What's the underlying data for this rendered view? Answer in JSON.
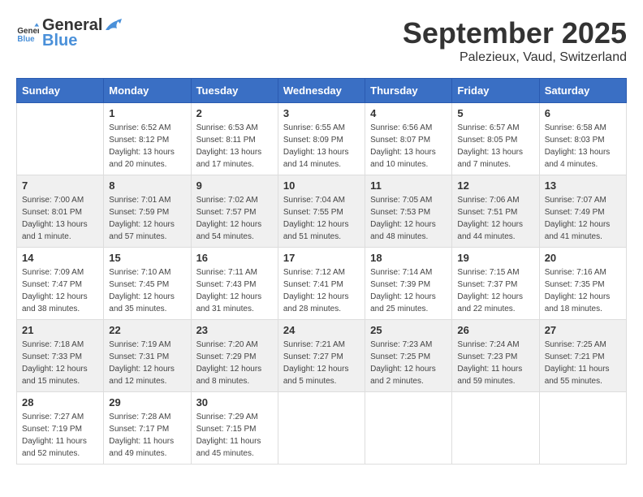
{
  "header": {
    "logo_general": "General",
    "logo_blue": "Blue",
    "month": "September 2025",
    "location": "Palezieux, Vaud, Switzerland"
  },
  "weekdays": [
    "Sunday",
    "Monday",
    "Tuesday",
    "Wednesday",
    "Thursday",
    "Friday",
    "Saturday"
  ],
  "weeks": [
    [
      {
        "day": "",
        "info": ""
      },
      {
        "day": "1",
        "info": "Sunrise: 6:52 AM\nSunset: 8:12 PM\nDaylight: 13 hours\nand 20 minutes."
      },
      {
        "day": "2",
        "info": "Sunrise: 6:53 AM\nSunset: 8:11 PM\nDaylight: 13 hours\nand 17 minutes."
      },
      {
        "day": "3",
        "info": "Sunrise: 6:55 AM\nSunset: 8:09 PM\nDaylight: 13 hours\nand 14 minutes."
      },
      {
        "day": "4",
        "info": "Sunrise: 6:56 AM\nSunset: 8:07 PM\nDaylight: 13 hours\nand 10 minutes."
      },
      {
        "day": "5",
        "info": "Sunrise: 6:57 AM\nSunset: 8:05 PM\nDaylight: 13 hours\nand 7 minutes."
      },
      {
        "day": "6",
        "info": "Sunrise: 6:58 AM\nSunset: 8:03 PM\nDaylight: 13 hours\nand 4 minutes."
      }
    ],
    [
      {
        "day": "7",
        "info": "Sunrise: 7:00 AM\nSunset: 8:01 PM\nDaylight: 13 hours\nand 1 minute."
      },
      {
        "day": "8",
        "info": "Sunrise: 7:01 AM\nSunset: 7:59 PM\nDaylight: 12 hours\nand 57 minutes."
      },
      {
        "day": "9",
        "info": "Sunrise: 7:02 AM\nSunset: 7:57 PM\nDaylight: 12 hours\nand 54 minutes."
      },
      {
        "day": "10",
        "info": "Sunrise: 7:04 AM\nSunset: 7:55 PM\nDaylight: 12 hours\nand 51 minutes."
      },
      {
        "day": "11",
        "info": "Sunrise: 7:05 AM\nSunset: 7:53 PM\nDaylight: 12 hours\nand 48 minutes."
      },
      {
        "day": "12",
        "info": "Sunrise: 7:06 AM\nSunset: 7:51 PM\nDaylight: 12 hours\nand 44 minutes."
      },
      {
        "day": "13",
        "info": "Sunrise: 7:07 AM\nSunset: 7:49 PM\nDaylight: 12 hours\nand 41 minutes."
      }
    ],
    [
      {
        "day": "14",
        "info": "Sunrise: 7:09 AM\nSunset: 7:47 PM\nDaylight: 12 hours\nand 38 minutes."
      },
      {
        "day": "15",
        "info": "Sunrise: 7:10 AM\nSunset: 7:45 PM\nDaylight: 12 hours\nand 35 minutes."
      },
      {
        "day": "16",
        "info": "Sunrise: 7:11 AM\nSunset: 7:43 PM\nDaylight: 12 hours\nand 31 minutes."
      },
      {
        "day": "17",
        "info": "Sunrise: 7:12 AM\nSunset: 7:41 PM\nDaylight: 12 hours\nand 28 minutes."
      },
      {
        "day": "18",
        "info": "Sunrise: 7:14 AM\nSunset: 7:39 PM\nDaylight: 12 hours\nand 25 minutes."
      },
      {
        "day": "19",
        "info": "Sunrise: 7:15 AM\nSunset: 7:37 PM\nDaylight: 12 hours\nand 22 minutes."
      },
      {
        "day": "20",
        "info": "Sunrise: 7:16 AM\nSunset: 7:35 PM\nDaylight: 12 hours\nand 18 minutes."
      }
    ],
    [
      {
        "day": "21",
        "info": "Sunrise: 7:18 AM\nSunset: 7:33 PM\nDaylight: 12 hours\nand 15 minutes."
      },
      {
        "day": "22",
        "info": "Sunrise: 7:19 AM\nSunset: 7:31 PM\nDaylight: 12 hours\nand 12 minutes."
      },
      {
        "day": "23",
        "info": "Sunrise: 7:20 AM\nSunset: 7:29 PM\nDaylight: 12 hours\nand 8 minutes."
      },
      {
        "day": "24",
        "info": "Sunrise: 7:21 AM\nSunset: 7:27 PM\nDaylight: 12 hours\nand 5 minutes."
      },
      {
        "day": "25",
        "info": "Sunrise: 7:23 AM\nSunset: 7:25 PM\nDaylight: 12 hours\nand 2 minutes."
      },
      {
        "day": "26",
        "info": "Sunrise: 7:24 AM\nSunset: 7:23 PM\nDaylight: 11 hours\nand 59 minutes."
      },
      {
        "day": "27",
        "info": "Sunrise: 7:25 AM\nSunset: 7:21 PM\nDaylight: 11 hours\nand 55 minutes."
      }
    ],
    [
      {
        "day": "28",
        "info": "Sunrise: 7:27 AM\nSunset: 7:19 PM\nDaylight: 11 hours\nand 52 minutes."
      },
      {
        "day": "29",
        "info": "Sunrise: 7:28 AM\nSunset: 7:17 PM\nDaylight: 11 hours\nand 49 minutes."
      },
      {
        "day": "30",
        "info": "Sunrise: 7:29 AM\nSunset: 7:15 PM\nDaylight: 11 hours\nand 45 minutes."
      },
      {
        "day": "",
        "info": ""
      },
      {
        "day": "",
        "info": ""
      },
      {
        "day": "",
        "info": ""
      },
      {
        "day": "",
        "info": ""
      }
    ]
  ]
}
